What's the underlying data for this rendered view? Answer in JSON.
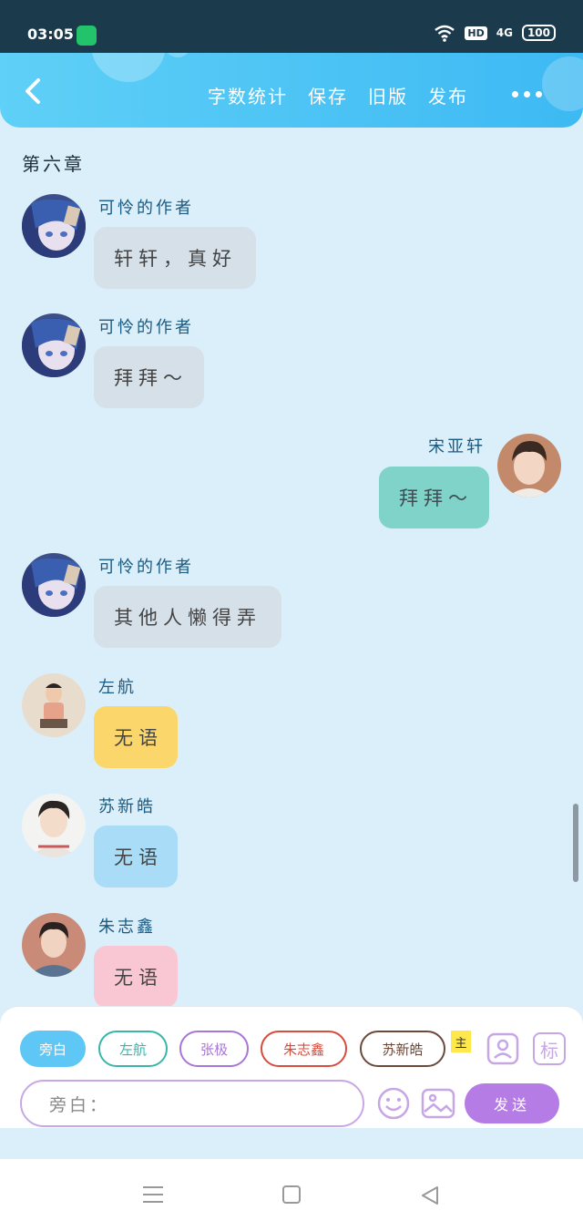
{
  "status_bar": {
    "time": "03:05",
    "network": "4G",
    "battery": "100",
    "hd": "HD"
  },
  "header": {
    "actions": [
      "字数统计",
      "保存",
      "旧版",
      "发布"
    ]
  },
  "chapter_title": "第六章",
  "messages": [
    {
      "sender": "可怜的作者",
      "text": "轩轩，真好",
      "side": "left",
      "color": "gray"
    },
    {
      "sender": "可怜的作者",
      "text": "拜拜～",
      "side": "left",
      "color": "gray"
    },
    {
      "sender": "宋亚轩",
      "text": "拜拜～",
      "side": "right",
      "color": "teal"
    },
    {
      "sender": "可怜的作者",
      "text": "其他人懒得弄",
      "side": "left",
      "color": "gray"
    },
    {
      "sender": "左航",
      "text": "无语",
      "side": "left",
      "color": "yellow"
    },
    {
      "sender": "苏新皓",
      "text": "无语",
      "side": "left",
      "color": "blue"
    },
    {
      "sender": "朱志鑫",
      "text": "无语",
      "side": "left",
      "color": "pink"
    }
  ],
  "roles": [
    "旁白",
    "左航",
    "张极",
    "朱志鑫",
    "苏新皓"
  ],
  "main_tag": "主",
  "label_button": "标",
  "input": {
    "value": "旁白："
  },
  "send_label": "发送",
  "colors": {
    "header": "#3db9f3",
    "background": "#dbeffa",
    "send": "#b57ce6"
  }
}
